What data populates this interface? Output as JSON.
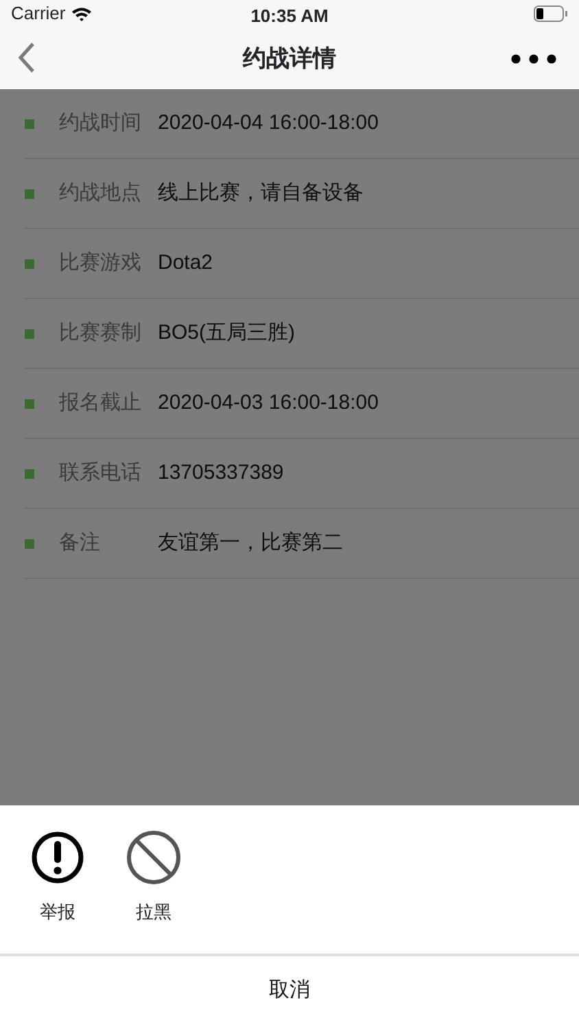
{
  "status_bar": {
    "carrier": "Carrier",
    "time": "10:35 AM"
  },
  "nav": {
    "title": "约战详情"
  },
  "details": [
    {
      "label": "约战时间",
      "value": "2020-04-04 16:00-18:00"
    },
    {
      "label": "约战地点",
      "value": "线上比赛，请自备设备"
    },
    {
      "label": "比赛游戏",
      "value": "Dota2"
    },
    {
      "label": "比赛赛制",
      "value": "BO5(五局三胜)"
    },
    {
      "label": "报名截止",
      "value": "2020-04-03 16:00-18:00"
    },
    {
      "label": "联系电话",
      "value": "13705337389"
    },
    {
      "label": "备注",
      "value": "友谊第一，比赛第二"
    }
  ],
  "action_sheet": {
    "actions": [
      {
        "kind": "report",
        "label": "举报"
      },
      {
        "kind": "block",
        "label": "拉黑"
      }
    ],
    "cancel": "取消"
  }
}
